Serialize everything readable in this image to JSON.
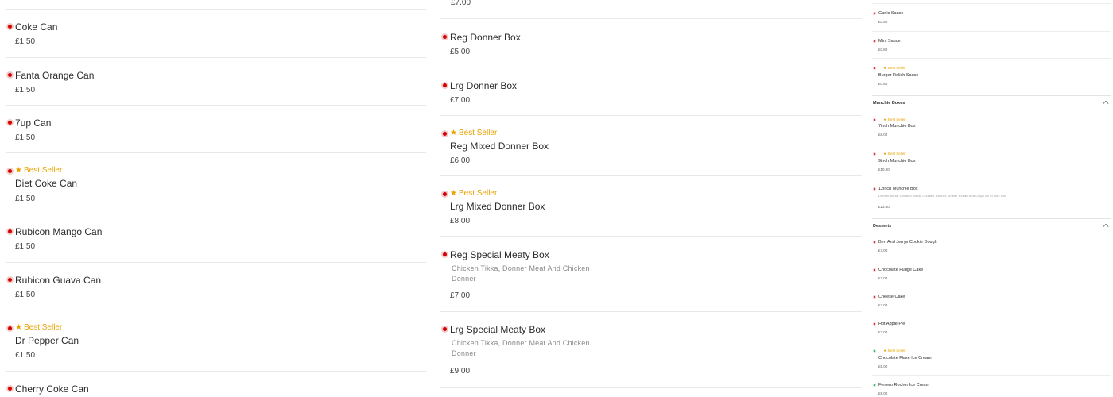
{
  "left_column": [
    {
      "name": "Coke Can",
      "price": "£1.50",
      "best_seller": false
    },
    {
      "name": "Fanta Orange Can",
      "price": "£1.50",
      "best_seller": false
    },
    {
      "name": "7up Can",
      "price": "£1.50",
      "best_seller": false
    },
    {
      "name": "Diet Coke Can",
      "price": "£1.50",
      "best_seller": true
    },
    {
      "name": "Rubicon Mango Can",
      "price": "£1.50",
      "best_seller": false
    },
    {
      "name": "Rubicon Guava Can",
      "price": "£1.50",
      "best_seller": false
    },
    {
      "name": "Dr Pepper Can",
      "price": "£1.50",
      "best_seller": true
    },
    {
      "name": "Cherry Coke Can",
      "price": "",
      "best_seller": false
    }
  ],
  "middle_column": {
    "top_price": "£7.00",
    "items": [
      {
        "name": "Reg Donner Box",
        "price": "£5.00",
        "best_seller": false,
        "description": ""
      },
      {
        "name": "Lrg Donner Box",
        "price": "£7.00",
        "best_seller": false,
        "description": ""
      },
      {
        "name": "Reg Mixed Donner Box",
        "price": "£6.00",
        "best_seller": true,
        "description": ""
      },
      {
        "name": "Lrg Mixed Donner Box",
        "price": "£8.00",
        "best_seller": true,
        "description": ""
      },
      {
        "name": "Reg Special Meaty Box",
        "price": "£7.00",
        "best_seller": false,
        "description": "Chicken Tikka, Donner Meat And Chicken Donner"
      },
      {
        "name": "Lrg Special Meaty Box",
        "price": "£9.00",
        "best_seller": false,
        "description": "Chicken Tikka, Donner Meat And Chicken Donner"
      }
    ]
  },
  "best_seller_label": "Best Seller",
  "right_column": {
    "sauces": [
      {
        "name": "Garlic Sauce",
        "price": "£0.80",
        "best_seller": false
      },
      {
        "name": "Mint Sauce",
        "price": "£0.80",
        "best_seller": false
      },
      {
        "name": "Burger Relish Sauce",
        "price": "£0.80",
        "best_seller": true
      }
    ],
    "munchie_title": "Munchie Boxes",
    "munchie": [
      {
        "name": "7inch Munchie Box",
        "price": "£8.00",
        "best_seller": true,
        "description": ""
      },
      {
        "name": "9inch Munchie Box",
        "price": "£10.00",
        "best_seller": true,
        "description": ""
      },
      {
        "name": "12inch Munchie Box",
        "price": "£13.50",
        "best_seller": false,
        "description": "Donner Meat, Chicken Tikka, Chicken Donner, Sheek Kebab And Chips All In One Box"
      }
    ],
    "desserts_title": "Desserts",
    "desserts": [
      {
        "name": "Ben And Jerrys Cookie Dough",
        "price": "£7.00",
        "best_seller": false,
        "veg": false
      },
      {
        "name": "Chocolate Fudge Cake",
        "price": "£3.00",
        "best_seller": false,
        "veg": false
      },
      {
        "name": "Cheese Cake",
        "price": "£3.00",
        "best_seller": false,
        "veg": false
      },
      {
        "name": "Hot Apple Pie",
        "price": "£2.00",
        "best_seller": false,
        "veg": false
      },
      {
        "name": "Chocolate Flake Ice Cream",
        "price": "£5.00",
        "best_seller": true,
        "veg": true
      },
      {
        "name": "Ferrero Rocher Ice Cream",
        "price": "£5.00",
        "best_seller": false,
        "veg": true
      }
    ]
  },
  "colors": {
    "nonveg": "#d40000",
    "veg": "#1f9a3b",
    "best_seller": "#e8a300"
  },
  "icons": {
    "indicator": "food-type-dot-icon",
    "badge": "star-icon",
    "collapse": "chevron-up-icon"
  }
}
